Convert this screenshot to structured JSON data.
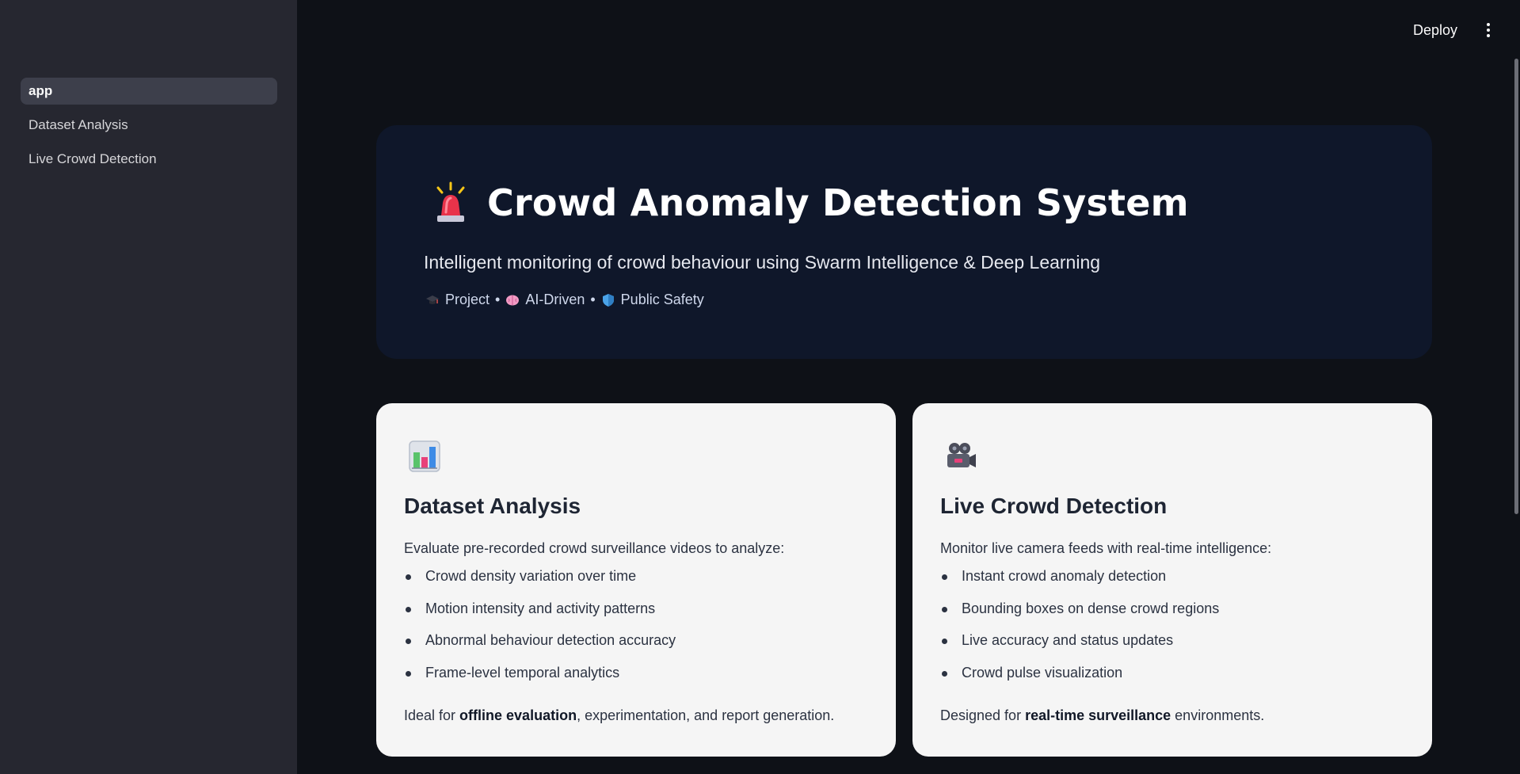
{
  "sidebar": {
    "items": [
      {
        "label": "app",
        "active": true
      },
      {
        "label": "Dataset Analysis",
        "active": false
      },
      {
        "label": "Live Crowd Detection",
        "active": false
      }
    ]
  },
  "header": {
    "deploy_label": "Deploy",
    "menu_icon": "more-vertical-icon"
  },
  "hero": {
    "icon": "siren-icon",
    "title": "Crowd Anomaly Detection System",
    "subtitle": "Intelligent monitoring of crowd behaviour using Swarm Intelligence & Deep Learning",
    "tags": [
      {
        "icon": "graduation-cap-icon",
        "label": "Project"
      },
      {
        "icon": "brain-icon",
        "label": "AI-Driven"
      },
      {
        "icon": "shield-icon",
        "label": "Public Safety"
      }
    ],
    "separator": "•"
  },
  "cards": [
    {
      "icon": "bar-chart-icon",
      "title": "Dataset Analysis",
      "intro": "Evaluate pre-recorded crowd surveillance videos to analyze:",
      "items": [
        "Crowd density variation over time",
        "Motion intensity and activity patterns",
        "Abnormal behaviour detection accuracy",
        "Frame-level temporal analytics"
      ],
      "footer_prefix": "Ideal for ",
      "footer_bold": "offline evaluation",
      "footer_suffix": ", experimentation, and report generation."
    },
    {
      "icon": "movie-camera-icon",
      "title": "Live Crowd Detection",
      "intro": "Monitor live camera feeds with real-time intelligence:",
      "items": [
        "Instant crowd anomaly detection",
        "Bounding boxes on dense crowd regions",
        "Live accuracy and status updates",
        "Crowd pulse visualization"
      ],
      "footer_prefix": "Designed for ",
      "footer_bold": "real-time surveillance",
      "footer_suffix": " environments."
    }
  ],
  "colors": {
    "background": "#0e1117",
    "sidebar": "#262730",
    "hero": "#0f172a",
    "card": "#f5f5f5"
  }
}
